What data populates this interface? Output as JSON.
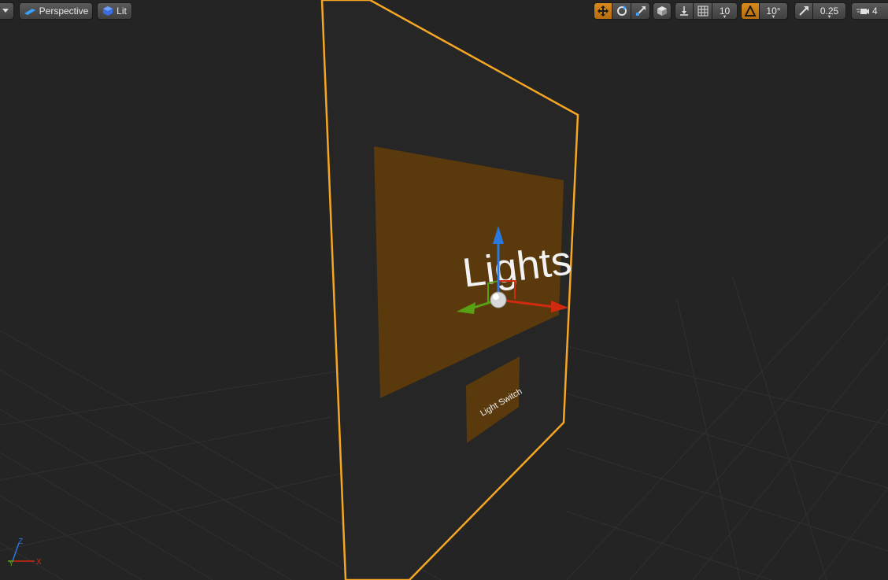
{
  "toolbar": {
    "view_mode_label": "Perspective",
    "lighting_mode_label": "Lit",
    "grid_snap_value": "10",
    "rotation_snap_value": "10°",
    "scale_snap_value": "0.25",
    "camera_speed_value": "4"
  },
  "scene": {
    "title_text": "Lights",
    "button_text": "Light Switch"
  },
  "axis_indicator": {
    "x_label": "X",
    "y_label": "Y",
    "z_label": "Z"
  },
  "colors": {
    "selection_outline": "#f5a623",
    "panel_fill": "#5a3a0c",
    "axis_x": "#d22a10",
    "axis_y": "#5aa014",
    "axis_z": "#2a78e0"
  }
}
